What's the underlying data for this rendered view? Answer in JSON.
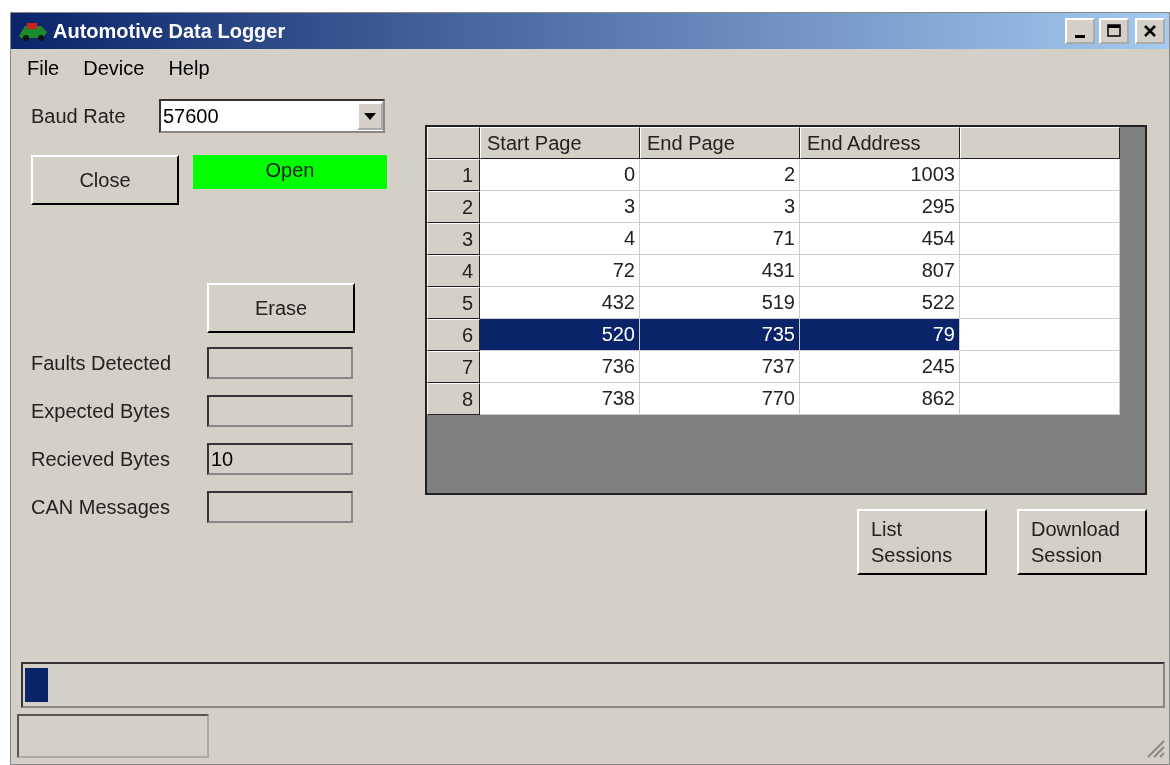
{
  "window": {
    "title": "Automotive Data Logger"
  },
  "menu": [
    "File",
    "Device",
    "Help"
  ],
  "baud": {
    "label": "Baud Rate",
    "value": "57600"
  },
  "close_button": "Close",
  "status": {
    "text": "Open",
    "color": "#00ff00"
  },
  "erase_button": "Erase",
  "fields": [
    {
      "label": "Faults Detected"
    },
    {
      "label": "Expected Bytes"
    },
    {
      "label": "Recieved Bytes",
      "value": "10"
    },
    {
      "label": "CAN Messages"
    }
  ],
  "table": {
    "columns": [
      "Start Page",
      "End Page",
      "End Address"
    ],
    "rows": [
      {
        "index": "1",
        "cells": [
          "0",
          "2",
          "1003"
        ],
        "selected": false
      },
      {
        "index": "2",
        "cells": [
          "3",
          "3",
          "295"
        ],
        "selected": false
      },
      {
        "index": "3",
        "cells": [
          "4",
          "71",
          "454"
        ],
        "selected": false
      },
      {
        "index": "4",
        "cells": [
          "72",
          "431",
          "807"
        ],
        "selected": false
      },
      {
        "index": "5",
        "cells": [
          "432",
          "519",
          "522"
        ],
        "selected": false
      },
      {
        "index": "6",
        "cells": [
          "520",
          "735",
          "79"
        ],
        "selected": true
      },
      {
        "index": "7",
        "cells": [
          "736",
          "737",
          "245"
        ],
        "selected": false
      },
      {
        "index": "8",
        "cells": [
          "738",
          "770",
          "862"
        ],
        "selected": false
      }
    ]
  },
  "buttons": [
    "List\nSessions",
    "Download\nSession"
  ],
  "progress": {
    "level": 0.02
  }
}
